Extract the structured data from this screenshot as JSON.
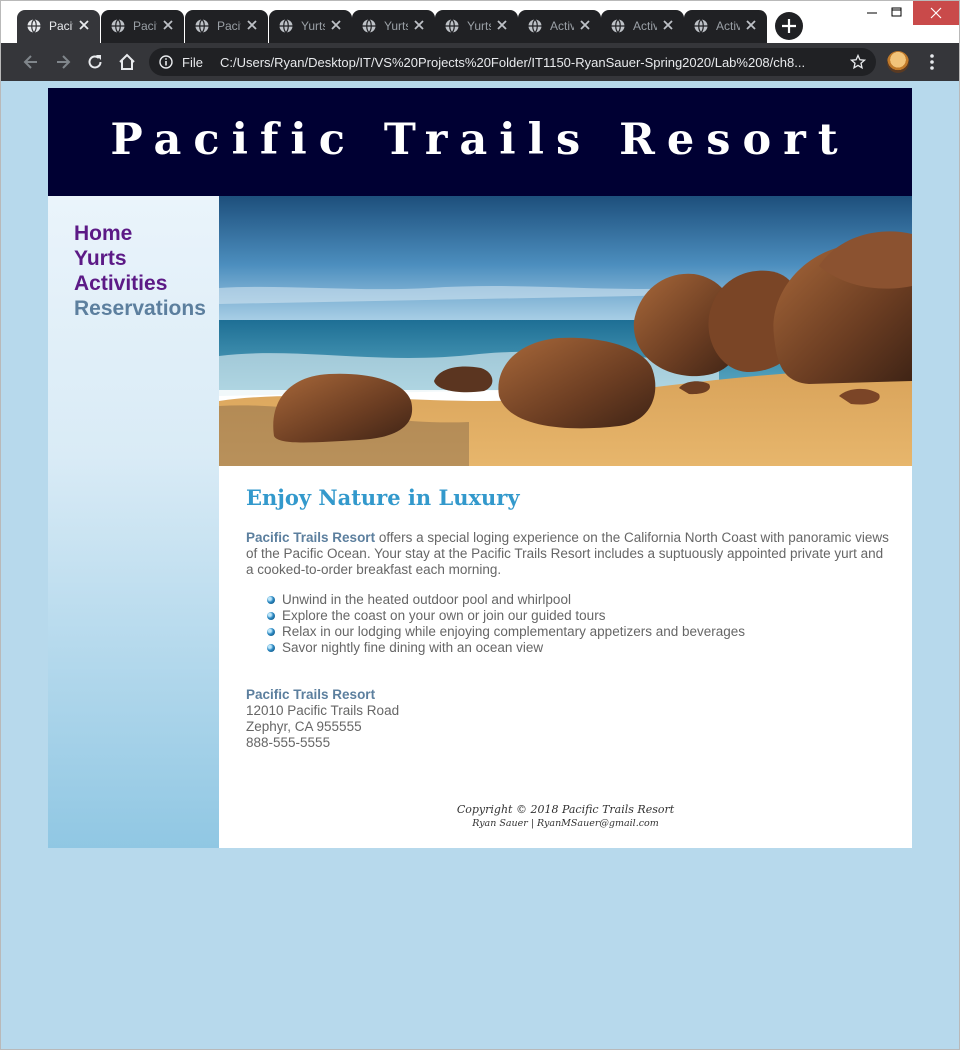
{
  "browser": {
    "tabs": [
      {
        "title": "Pacific Trails Resort",
        "active": true
      },
      {
        "title": "Pacific Trails Resort",
        "active": false
      },
      {
        "title": "Pacific Trails Resort",
        "active": false
      },
      {
        "title": "Yurts",
        "active": false
      },
      {
        "title": "Yurts",
        "active": false
      },
      {
        "title": "Yurts",
        "active": false
      },
      {
        "title": "Activities",
        "active": false
      },
      {
        "title": "Activities",
        "active": false
      },
      {
        "title": "Activities",
        "active": false
      }
    ],
    "scheme_label": "File",
    "url": "C:/Users/Ryan/Desktop/IT/VS%20Projects%20Folder/IT1150-RyanSauer-Spring2020/Lab%208/ch8..."
  },
  "page": {
    "site_title": "Pacific Trails Resort",
    "nav": {
      "items": [
        {
          "label": "Home"
        },
        {
          "label": "Yurts"
        },
        {
          "label": "Activities"
        },
        {
          "label": "Reservations"
        }
      ]
    },
    "heading": "Enjoy Nature in Luxury",
    "intro_name": "Pacific Trails Resort",
    "intro_text": " offers a special loging experience on the California North Coast with panoramic views of the Pacific Ocean. Your stay at the Pacific Trails Resort includes a suptuously appointed private yurt and a cooked-to-order breakfast each morning.",
    "features": [
      "Unwind in the heated outdoor pool and whirlpool",
      "Explore the coast on your own or join our guided tours",
      "Relax in our lodging while enjoying complementary appetizers and beverages",
      "Savor nightly fine dining with an ocean view"
    ],
    "contact": {
      "name": "Pacific Trails Resort",
      "street": "12010 Pacific Trails Road",
      "city": "Zephyr, CA 955555",
      "phone": "888-555-5555"
    },
    "footer": {
      "copyright": "Copyright © 2018 Pacific Trails Resort",
      "credit": "Ryan Sauer | RyanMSauer@gmail.com"
    }
  },
  "colors": {
    "page_bg": "#b7d9ec",
    "header_bg": "#000033",
    "nav_link": "#5c1a86",
    "nav_current": "#5c7f9e",
    "heading": "#3399cc",
    "body_text": "#666666"
  },
  "icons": {
    "tab_favicon": "globe-icon",
    "tab_close": "close-icon",
    "back": "arrow-left-icon",
    "forward": "arrow-right-icon",
    "reload": "reload-icon",
    "home": "home-icon",
    "info": "info-icon",
    "bookmark": "star-icon",
    "menu": "kebab-menu-icon"
  }
}
